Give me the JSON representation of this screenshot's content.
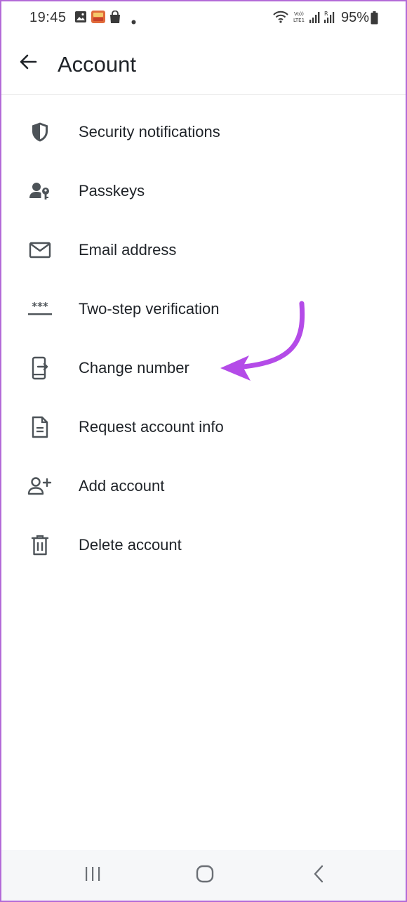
{
  "status_bar": {
    "time": "19:45",
    "battery_percent": "95%",
    "icons_left": [
      "gallery-icon",
      "app-notification-icon",
      "shopping-bag-icon",
      "dot-icon"
    ],
    "icons_right": [
      "wifi-icon",
      "volte-icon",
      "signal-icon",
      "signal-roaming-icon",
      "battery-icon"
    ]
  },
  "app_bar": {
    "title": "Account"
  },
  "menu": {
    "items": [
      {
        "label": "Security notifications",
        "icon": "shield-icon"
      },
      {
        "label": "Passkeys",
        "icon": "passkey-icon"
      },
      {
        "label": "Email address",
        "icon": "mail-icon"
      },
      {
        "label": "Two-step verification",
        "icon": "pin-dots-icon"
      },
      {
        "label": "Change number",
        "icon": "phone-transfer-icon"
      },
      {
        "label": "Request account info",
        "icon": "document-icon"
      },
      {
        "label": "Add account",
        "icon": "add-person-icon"
      },
      {
        "label": "Delete account",
        "icon": "trash-icon"
      }
    ]
  },
  "colors": {
    "accent_arrow": "#b44be8",
    "icon": "#4d5358",
    "text": "#1f2328",
    "nav_bar_bg": "#f6f7f9",
    "frame_border": "#b36ad8"
  },
  "nav_bar": {
    "buttons": [
      "recents-icon",
      "home-icon",
      "back-nav-icon"
    ]
  }
}
